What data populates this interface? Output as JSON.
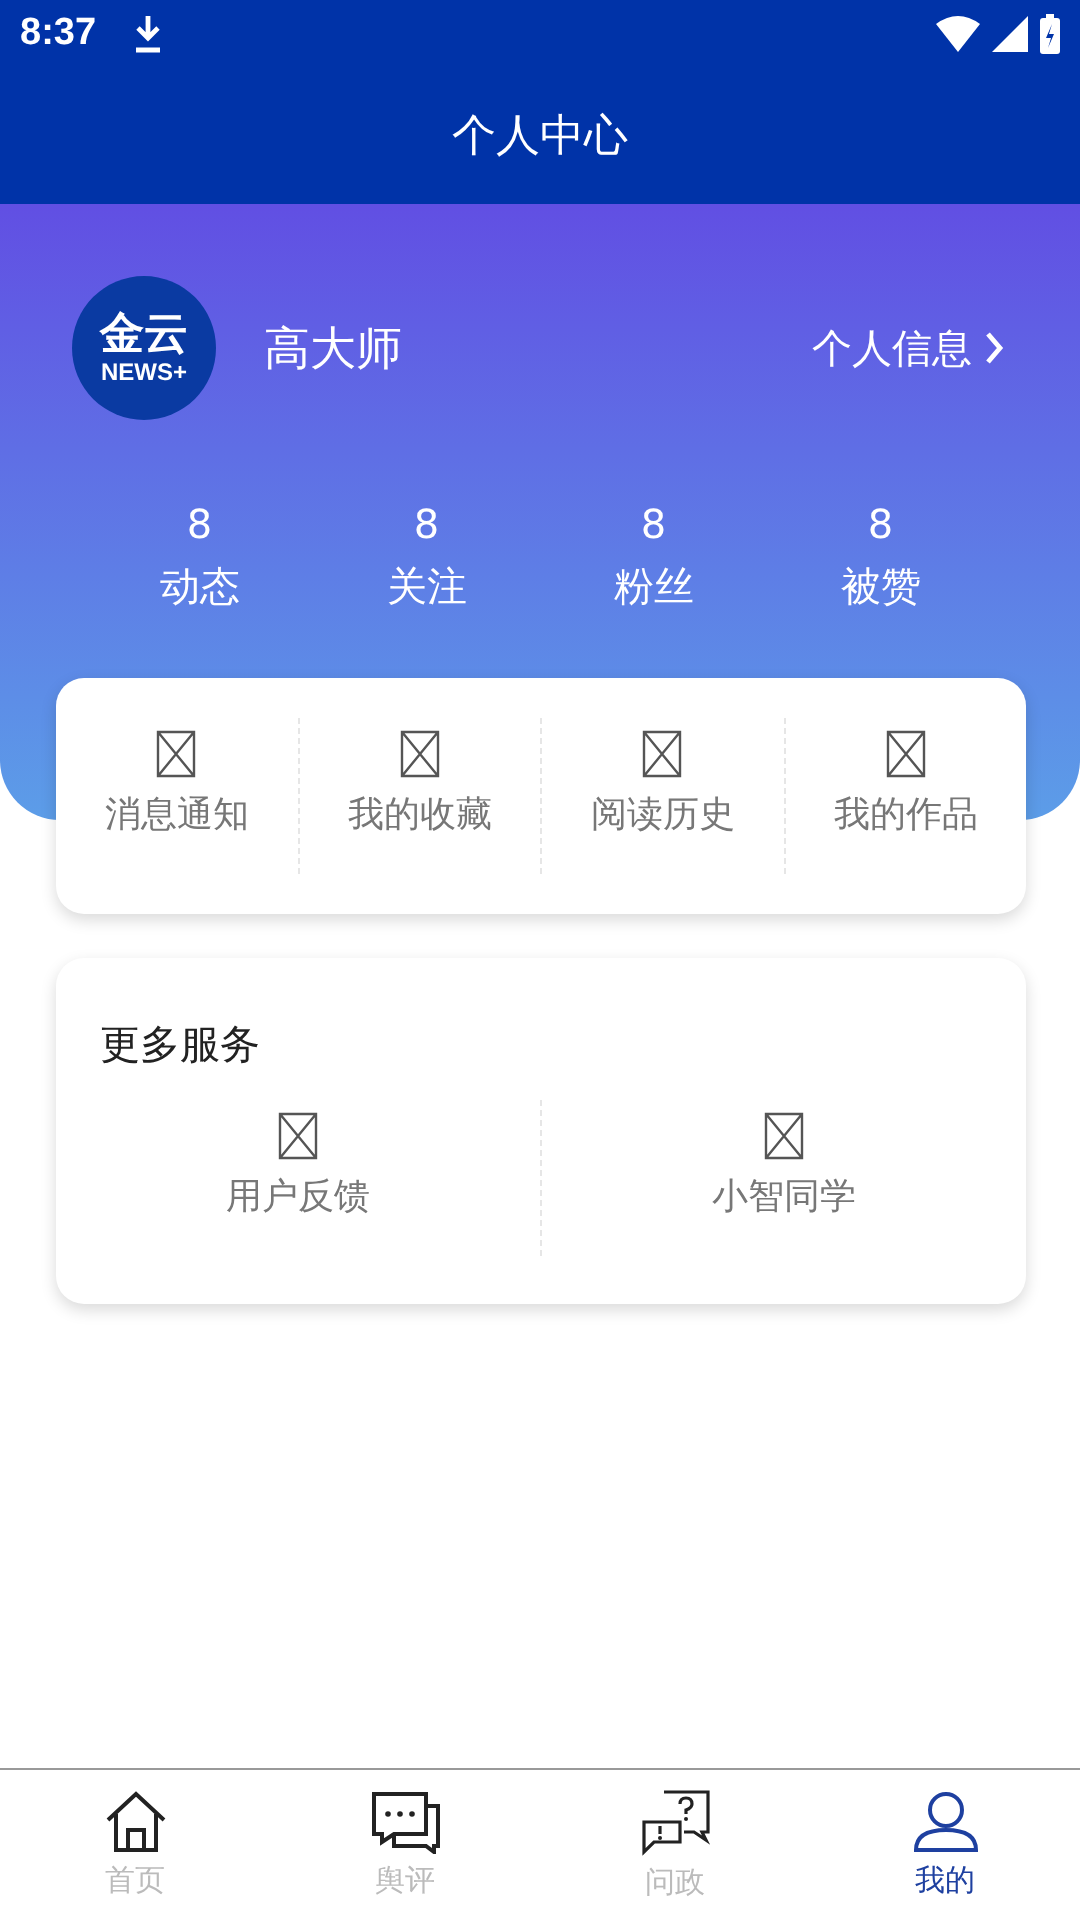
{
  "status_bar": {
    "time": "8:37"
  },
  "header": {
    "title": "个人中心"
  },
  "profile": {
    "logo_text": "金云",
    "logo_subtext": "NEWS+",
    "name": "高大师",
    "info_link": "个人信息"
  },
  "stats": [
    {
      "value": "8",
      "label": "动态"
    },
    {
      "value": "8",
      "label": "关注"
    },
    {
      "value": "8",
      "label": "粉丝"
    },
    {
      "value": "8",
      "label": "被赞"
    }
  ],
  "quick_actions": [
    {
      "label": "消息通知"
    },
    {
      "label": "我的收藏"
    },
    {
      "label": "阅读历史"
    },
    {
      "label": "我的作品"
    }
  ],
  "more_services": {
    "title": "更多服务",
    "items": [
      {
        "label": "用户反馈"
      },
      {
        "label": "小智同学"
      }
    ]
  },
  "bottom_nav": [
    {
      "kind": "home",
      "label": "首页",
      "selected": false
    },
    {
      "kind": "comments",
      "label": "舆评",
      "selected": false
    },
    {
      "kind": "questions",
      "label": "问政",
      "selected": false
    },
    {
      "kind": "profile",
      "label": "我的",
      "selected": true
    }
  ]
}
